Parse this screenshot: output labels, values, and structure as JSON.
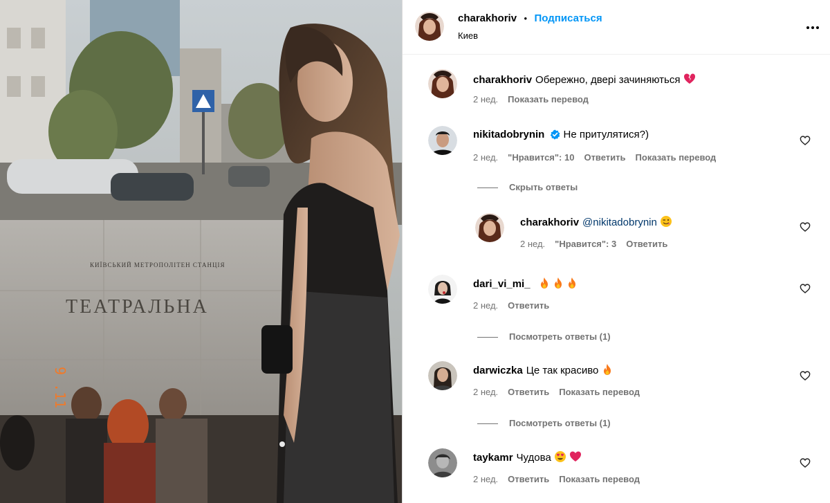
{
  "photo": {
    "sign_small": "КИЇВСЬКИЙ МЕТРОПОЛІТЕН СТАНЦІЯ",
    "sign_big": "ТЕАТРАЛЬНА",
    "date_stamp": "9 .11 '23"
  },
  "header": {
    "username": "charakhoriv",
    "separator": "•",
    "follow_label": "Подписаться",
    "location": "Киев"
  },
  "caption": {
    "username": "charakhoriv",
    "text": "Обережно, двері зачиняються",
    "age": "2 нед.",
    "translate": "Показать перевод"
  },
  "comments": [
    {
      "username": "nikitadobrynin",
      "text": "Не притулятися?)",
      "age": "2 нед.",
      "likes": "\"Нравится\": 10",
      "reply": "Ответить",
      "translate": "Показать перевод",
      "replies_toggle": "Скрыть ответы"
    },
    {
      "username": "charakhoriv",
      "mention": "@nikitadobrynin",
      "age": "2 нед.",
      "likes": "\"Нравится\": 3",
      "reply": "Ответить"
    },
    {
      "username": "dari_vi_mi_",
      "age": "2 нед.",
      "reply": "Ответить",
      "replies_toggle": "Посмотреть ответы (1)"
    },
    {
      "username": "darwiczka",
      "text": "Це так красиво",
      "age": "2 нед.",
      "reply": "Ответить",
      "translate": "Показать перевод",
      "replies_toggle": "Посмотреть ответы (1)"
    },
    {
      "username": "taykamr",
      "text": "Чудова",
      "age": "2 нед.",
      "reply": "Ответить",
      "translate": "Показать перевод"
    }
  ],
  "icons": {
    "more": "more-horizontal-icon",
    "like": "heart-outline-icon",
    "verified": "verified-badge-icon",
    "broken_heart": "broken-heart-emoji",
    "fire": "fire-emoji",
    "wink": "winking-face-emoji",
    "heart_eyes": "heart-eyes-emoji",
    "red_heart": "red-heart-emoji"
  },
  "colors": {
    "link": "#0095f6",
    "secondary_text": "#737373",
    "verified": "#0095f6",
    "fire": "#f97a1b",
    "heart": "#e0245e"
  }
}
